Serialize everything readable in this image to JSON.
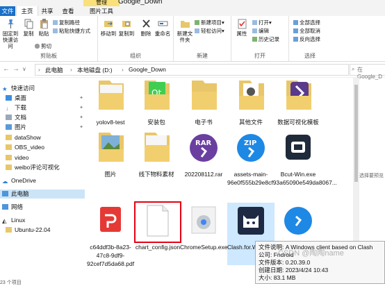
{
  "window": {
    "title": "Google_Down",
    "context_tab": "管理"
  },
  "ribbon_tabs": {
    "file": "文件",
    "home": "主页",
    "share": "共享",
    "view": "查看",
    "picture_tools": "图片工具"
  },
  "ribbon": {
    "clipboard": {
      "pin": "固定到快速访问",
      "copy": "复制",
      "paste": "粘贴",
      "copy_path": "复制路径",
      "paste_shortcut": "粘贴快捷方式",
      "cut": "剪切",
      "group": "剪贴板"
    },
    "organize": {
      "move_to": "移动到",
      "copy_to": "复制到",
      "delete": "删除",
      "rename": "重命名",
      "group": "组织"
    },
    "new": {
      "new_folder": "新建文件夹",
      "new_item": "新建项目▾",
      "easy_access": "轻松访问▾",
      "group": "新建"
    },
    "open": {
      "properties": "属性",
      "open": "打开▾",
      "edit": "编辑",
      "history": "历史记录",
      "group": "打开"
    },
    "select": {
      "select_all": "全部选择",
      "select_none": "全部取消",
      "invert": "反向选择",
      "group": "选择"
    }
  },
  "address": {
    "crumbs": [
      "此电脑",
      "本地磁盘 (D:)",
      "Google_Down"
    ],
    "search_placeholder": "在 Google_D"
  },
  "sidebar": {
    "quick_access": "快速访问",
    "desktop": "桌面",
    "downloads": "下载",
    "documents": "文档",
    "pictures": "图片",
    "dataShow": "dataShow",
    "obs": "OBS_video",
    "video": "video",
    "weibo": "weibo评论可视化",
    "onedrive": "OneDrive",
    "this_pc": "此电脑",
    "network": "网络",
    "linux": "Linux",
    "ubuntu": "Ubuntu-22.04"
  },
  "files": [
    {
      "name": "yolov8-test",
      "type": "folder"
    },
    {
      "name": "安装包",
      "type": "folder"
    },
    {
      "name": "电子书",
      "type": "folder"
    },
    {
      "name": "其他文件",
      "type": "folder"
    },
    {
      "name": "数据可视化模板",
      "type": "folder"
    },
    {
      "name": "图片",
      "type": "folder"
    },
    {
      "name": "线下物料素材",
      "type": "folder"
    },
    {
      "name": "202208112.rar",
      "type": "rar"
    },
    {
      "name": "assets-main-96e0f555b29e8cf93a65090e549da8067...",
      "type": "zip"
    },
    {
      "name": "Bcut-Win.exe",
      "type": "exe"
    },
    {
      "name": "c64ddf3b-8a23-47c8-9df9-92cef7d5da68.pdf",
      "type": "pdf"
    },
    {
      "name": "chart_config.json",
      "type": "json"
    },
    {
      "name": "ChromeSetup.exe",
      "type": "exe"
    },
    {
      "name": "Clash.for.Windows.Setup.0.20.39.exe",
      "type": "exe"
    },
    {
      "name": "",
      "type": "zip"
    }
  ],
  "scroll_hint": "选择要预览",
  "tooltip": {
    "desc": "文件说明: A Windows client based on Clash",
    "company": "公司: Fndroid",
    "version": "文件版本: 0.20.39.0",
    "created": "创建日期: 2023/4/24 10:43",
    "size": "大小: 83.1 MB"
  },
  "watermark": "CSDN @陶陶name",
  "statusbar": "23 个项目"
}
